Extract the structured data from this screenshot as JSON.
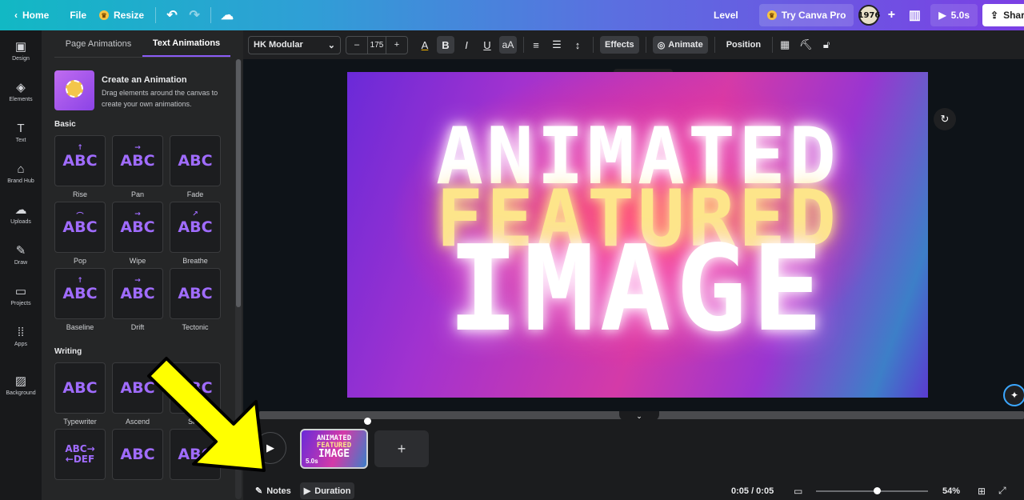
{
  "topbar": {
    "home": "Home",
    "file": "File",
    "resize": "Resize",
    "level": "Level",
    "try_pro": "Try Canva Pro",
    "avatar_text": "1976",
    "play_duration": "5.0s",
    "share": "Share"
  },
  "rail": [
    {
      "label": "Design",
      "glyph": "▣"
    },
    {
      "label": "Elements",
      "glyph": "◈"
    },
    {
      "label": "Text",
      "glyph": "T"
    },
    {
      "label": "Brand Hub",
      "glyph": "⌂"
    },
    {
      "label": "Uploads",
      "glyph": "☁"
    },
    {
      "label": "Draw",
      "glyph": "✎"
    },
    {
      "label": "Projects",
      "glyph": "▭"
    },
    {
      "label": "Apps",
      "glyph": "⁞⁞"
    },
    {
      "label": "Background",
      "glyph": "▨"
    }
  ],
  "panel": {
    "tabs": [
      "Page Animations",
      "Text Animations"
    ],
    "create_title": "Create an Animation",
    "create_desc": "Drag elements around the canvas to create your own animations.",
    "basic_heading": "Basic",
    "writing_heading": "Writing",
    "basic": [
      {
        "label": "Rise",
        "text": "ABC",
        "arrow": "↑"
      },
      {
        "label": "Pan",
        "text": "ABC",
        "arrow": "→"
      },
      {
        "label": "Fade",
        "text": "ABC",
        "arrow": ""
      },
      {
        "label": "Pop",
        "text": "ABC",
        "arrow": "⌒"
      },
      {
        "label": "Wipe",
        "text": "ABC",
        "arrow": "→"
      },
      {
        "label": "Breathe",
        "text": "ABC",
        "arrow": "↗"
      },
      {
        "label": "Baseline",
        "text": "ABC",
        "arrow": "↑"
      },
      {
        "label": "Drift",
        "text": "ABC",
        "arrow": "→"
      },
      {
        "label": "Tectonic",
        "text": "ABC",
        "arrow": ""
      }
    ],
    "writing": [
      {
        "label": "Typewriter",
        "text": "ABC",
        "arrow": ""
      },
      {
        "label": "Ascend",
        "text": "ABC",
        "arrow": ""
      },
      {
        "label": "Shift",
        "text": "ABC",
        "arrow": ""
      },
      {
        "label": "",
        "text": "ABC→ ←DEF",
        "arrow": ""
      },
      {
        "label": "",
        "text": "ABC",
        "arrow": ""
      },
      {
        "label": "",
        "text": "ABC",
        "arrow": ""
      }
    ]
  },
  "toolbar": {
    "font": "HK Modular",
    "size": "175",
    "minus": "–",
    "plus": "+",
    "effects": "Effects",
    "animate": "Animate",
    "position": "Position"
  },
  "canvas": {
    "line1": "ANIMATED",
    "line2": "FEATURED",
    "line3": "IMAGE"
  },
  "timeline": {
    "clip_duration": "5.0s",
    "add": "+",
    "notes": "Notes",
    "duration": "Duration",
    "time": "0:05 / 0:05",
    "zoom": "54%",
    "zoom_level": 0.54
  },
  "colors": {
    "accent": "#8b5cf6",
    "arrow_yellow": "#ffff00"
  }
}
